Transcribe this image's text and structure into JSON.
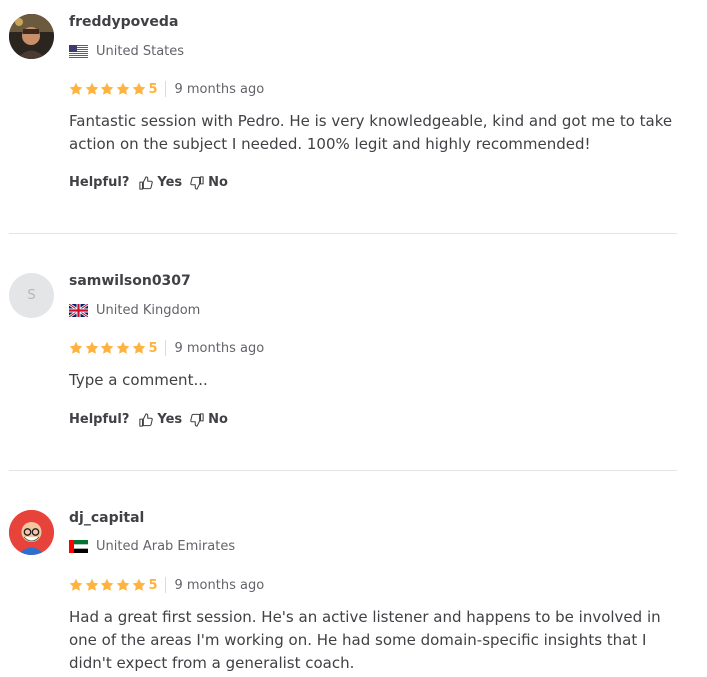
{
  "reviews": [
    {
      "username": "freddypoveda",
      "avatar_type": "photo",
      "country": "United States",
      "flag": "us-flag-icon",
      "score": "5",
      "time": "9 months ago",
      "comment": "Fantastic session with Pedro. He is very knowledgeable, kind and got me to take action on the subject I needed. 100% legit and highly recommended!",
      "helpful_label": "Helpful?",
      "yes_label": "Yes",
      "no_label": "No"
    },
    {
      "username": "samwilson0307",
      "avatar_type": "letter",
      "avatar_letter": "S",
      "country": "United Kingdom",
      "flag": "uk-flag-icon",
      "score": "5",
      "time": "9 months ago",
      "comment": "Type a comment...",
      "helpful_label": "Helpful?",
      "yes_label": "Yes",
      "no_label": "No"
    },
    {
      "username": "dj_capital",
      "avatar_type": "illustration",
      "country": "United Arab Emirates",
      "flag": "uae-flag-icon",
      "score": "5",
      "time": "9 months ago",
      "comment": "Had a great first session. He's an active listener and happens to be involved in one of the areas I'm working on. He had some domain-specific insights that I didn't expect from a generalist coach."
    }
  ],
  "colors": {
    "star": "#ffb33e",
    "text": "#404145",
    "muted": "#62646a",
    "divider": "#e4e5e7"
  }
}
